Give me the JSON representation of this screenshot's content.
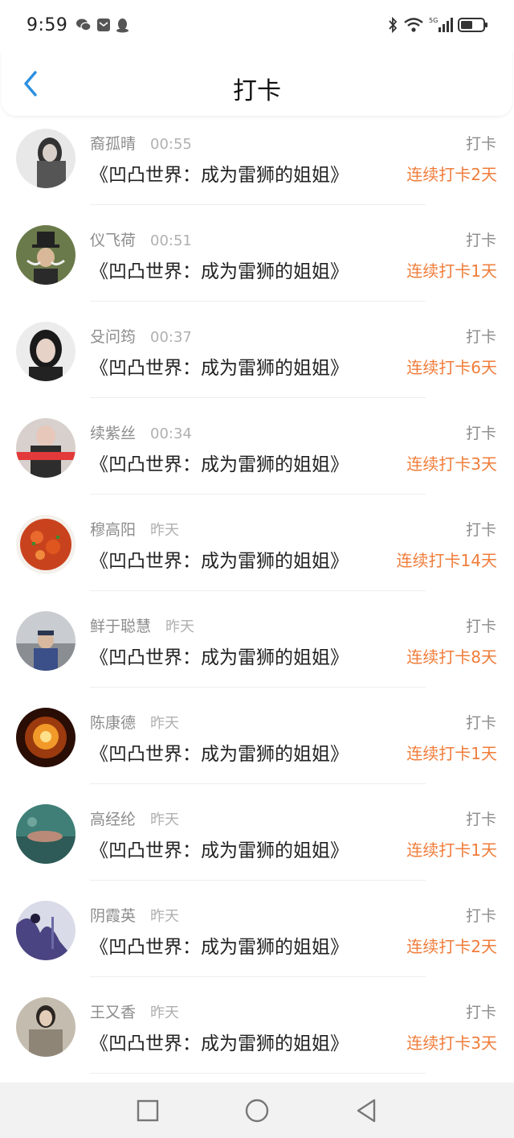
{
  "status_bar": {
    "time": "9:59",
    "network": "5G"
  },
  "header": {
    "title": "打卡"
  },
  "colors": {
    "accent": "#f07c3a",
    "back": "#2a8fe0"
  },
  "items": [
    {
      "name": "裔孤晴",
      "time": "00:55",
      "book": "《凹凸世界：成为雷狮的姐姐》",
      "action": "打卡",
      "streak": "连续打卡2天"
    },
    {
      "name": "仪飞荷",
      "time": "00:51",
      "book": "《凹凸世界：成为雷狮的姐姐》",
      "action": "打卡",
      "streak": "连续打卡1天"
    },
    {
      "name": "殳问筠",
      "time": "00:37",
      "book": "《凹凸世界：成为雷狮的姐姐》",
      "action": "打卡",
      "streak": "连续打卡6天"
    },
    {
      "name": "续紫丝",
      "time": "00:34",
      "book": "《凹凸世界：成为雷狮的姐姐》",
      "action": "打卡",
      "streak": "连续打卡3天"
    },
    {
      "name": "穆高阳",
      "time": "昨天",
      "book": "《凹凸世界：成为雷狮的姐姐》",
      "action": "打卡",
      "streak": "连续打卡14天"
    },
    {
      "name": "鲜于聪慧",
      "time": "昨天",
      "book": "《凹凸世界：成为雷狮的姐姐》",
      "action": "打卡",
      "streak": "连续打卡8天"
    },
    {
      "name": "陈康德",
      "time": "昨天",
      "book": "《凹凸世界：成为雷狮的姐姐》",
      "action": "打卡",
      "streak": "连续打卡1天"
    },
    {
      "name": "高经纶",
      "time": "昨天",
      "book": "《凹凸世界：成为雷狮的姐姐》",
      "action": "打卡",
      "streak": "连续打卡1天"
    },
    {
      "name": "阴霞英",
      "time": "昨天",
      "book": "《凹凸世界：成为雷狮的姐姐》",
      "action": "打卡",
      "streak": "连续打卡2天"
    },
    {
      "name": "王又香",
      "time": "昨天",
      "book": "《凹凸世界：成为雷狮的姐姐》",
      "action": "打卡",
      "streak": "连续打卡3天"
    }
  ]
}
